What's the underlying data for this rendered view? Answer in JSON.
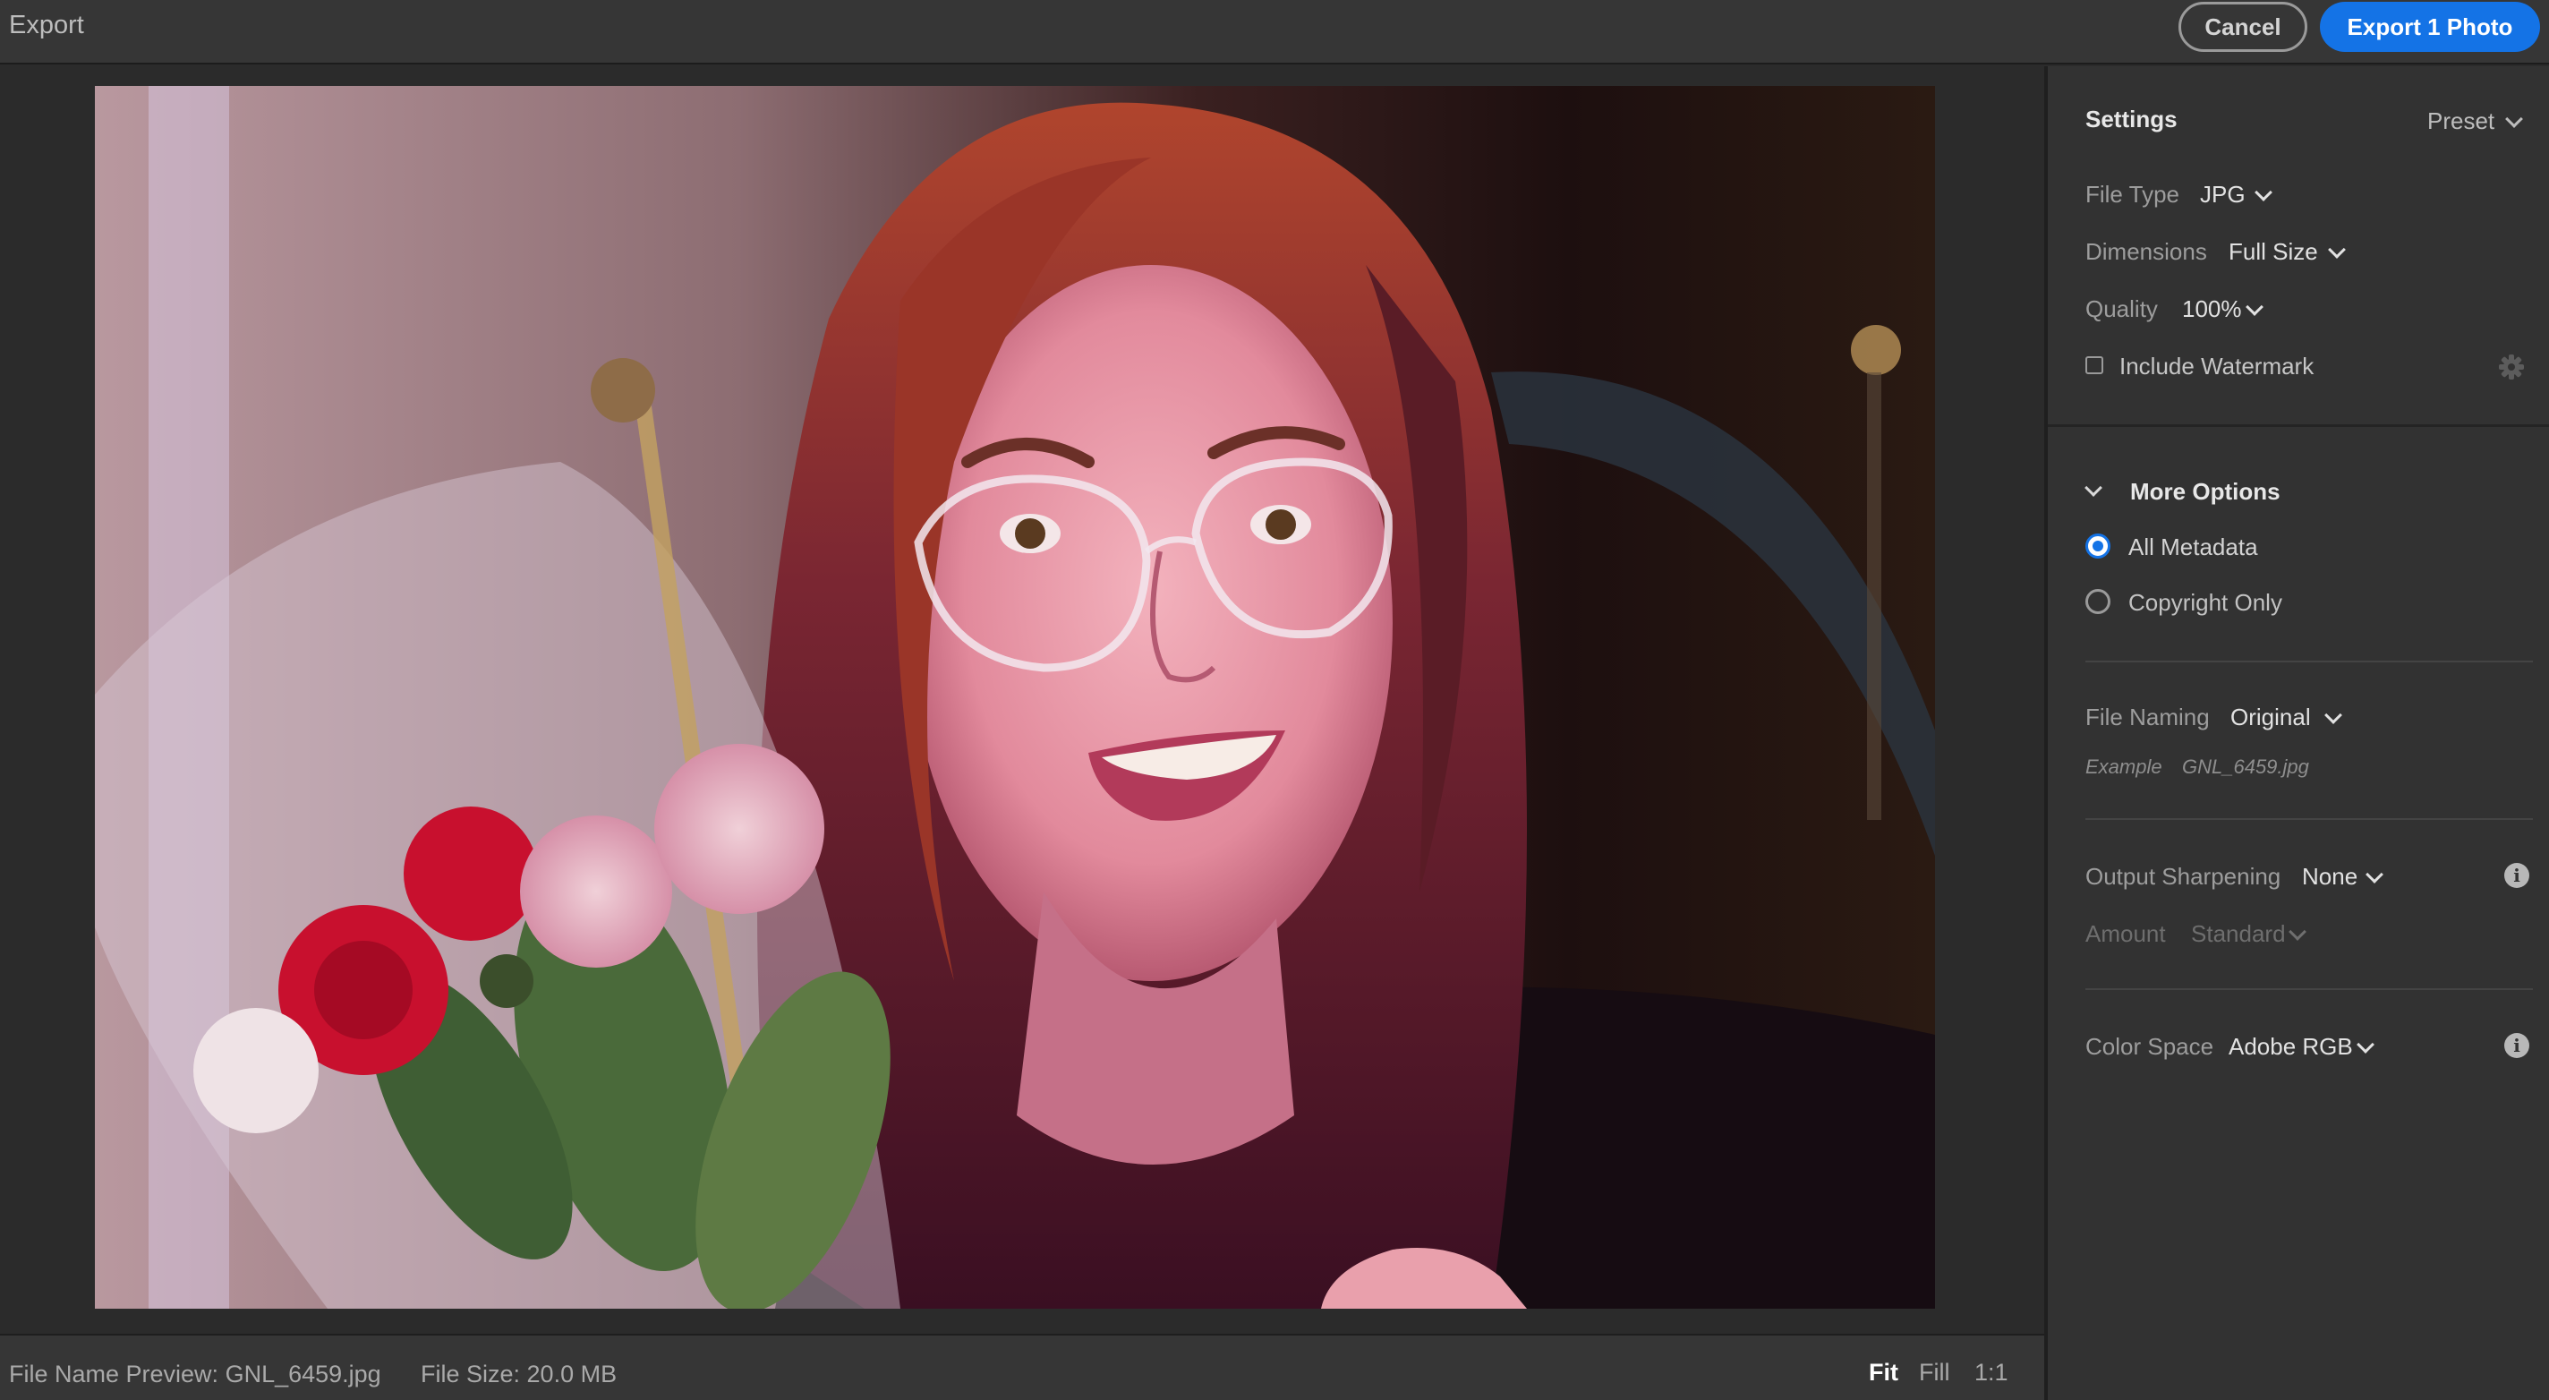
{
  "header": {
    "title": "Export",
    "cancel_label": "Cancel",
    "export_label": "Export 1 Photo"
  },
  "footer": {
    "file_name_preview": "File Name Preview: GNL_6459.jpg",
    "file_size": "File Size: 20.0 MB",
    "zoom": {
      "fit": "Fit",
      "fill": "Fill",
      "one_to_one": "1:1",
      "active": "fit"
    }
  },
  "panel": {
    "settings_label": "Settings",
    "preset_label": "Preset",
    "file_type": {
      "label": "File Type",
      "value": "JPG"
    },
    "dimensions": {
      "label": "Dimensions",
      "value": "Full Size"
    },
    "quality": {
      "label": "Quality",
      "value": "100%"
    },
    "watermark": {
      "label": "Include Watermark",
      "checked": false
    },
    "more_options": {
      "label": "More Options",
      "metadata_options": [
        {
          "label": "All Metadata",
          "selected": true
        },
        {
          "label": "Copyright Only",
          "selected": false
        }
      ]
    },
    "file_naming": {
      "label": "File Naming",
      "value": "Original",
      "example_label": "Example",
      "example_value": "GNL_6459.jpg"
    },
    "output_sharpening": {
      "label": "Output Sharpening",
      "value": "None"
    },
    "amount": {
      "label": "Amount",
      "value": "Standard"
    },
    "color_space": {
      "label": "Color Space",
      "value": "Adobe RGB"
    }
  },
  "colors": {
    "accent": "#1473e6",
    "top_bar": "#363636",
    "panel": "#323232",
    "preview_bg": "#2b2b2b"
  }
}
